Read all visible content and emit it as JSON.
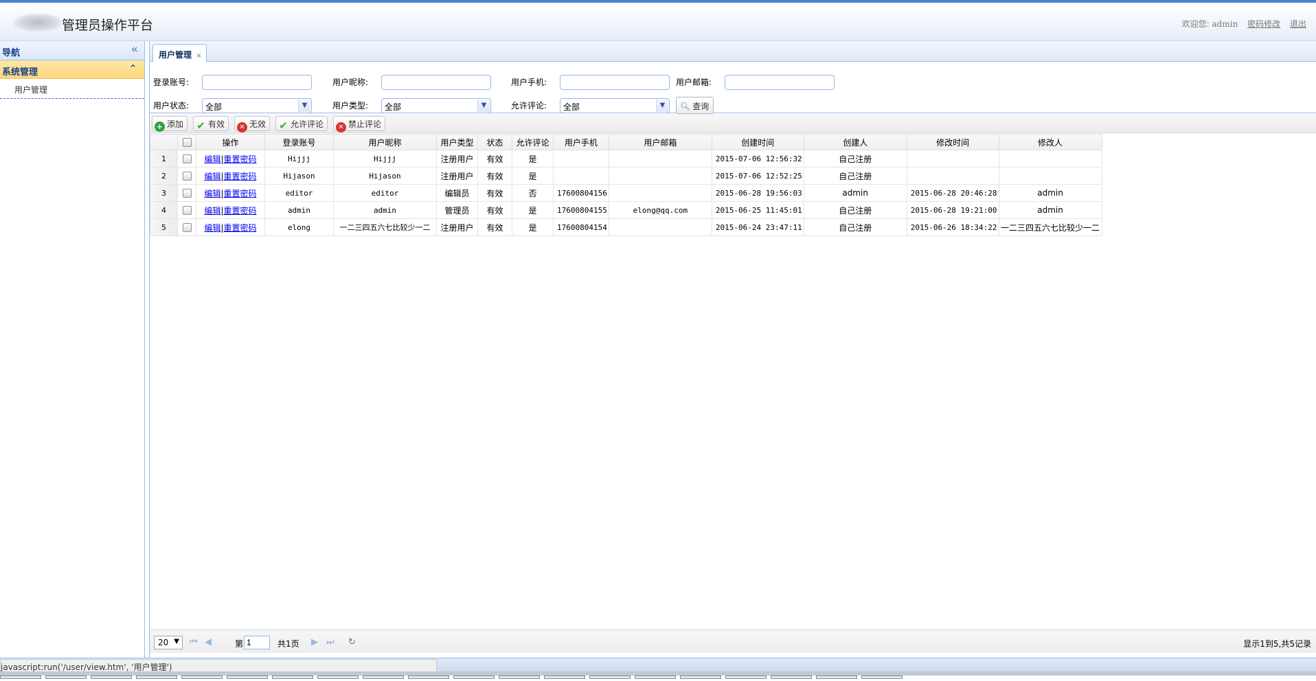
{
  "header": {
    "app_title": "管理员操作平台",
    "welcome": "欢迎您:",
    "username": "admin",
    "change_password": "密码修改",
    "logout": "退出"
  },
  "sidebar": {
    "title": "导航",
    "group_title": "系统管理",
    "items": [
      {
        "label": "用户管理"
      }
    ]
  },
  "tabs": [
    {
      "label": "用户管理",
      "close": "×"
    }
  ],
  "search": {
    "login_account": {
      "label": "登录账号:",
      "value": ""
    },
    "nickname": {
      "label": "用户昵称:",
      "value": ""
    },
    "phone": {
      "label": "用户手机:",
      "value": ""
    },
    "email": {
      "label": "用户邮箱:",
      "value": ""
    },
    "status": {
      "label": "用户状态:",
      "value": "全部"
    },
    "type": {
      "label": "用户类型:",
      "value": "全部"
    },
    "comment": {
      "label": "允许评论:",
      "value": "全部"
    },
    "query_button": "查询"
  },
  "toolbar": {
    "add": "添加",
    "valid": "有效",
    "invalid": "无效",
    "allow_comment": "允许评论",
    "forbid_comment": "禁止评论"
  },
  "grid": {
    "columns": [
      "操作",
      "登录账号",
      "用户昵称",
      "用户类型",
      "状态",
      "允许评论",
      "用户手机",
      "用户邮箱",
      "创建时间",
      "创建人",
      "修改时间",
      "修改人"
    ],
    "op_edit": "编辑",
    "op_sep": "|",
    "op_reset": "重置密码",
    "rows": [
      {
        "n": "1",
        "account": "Hijjj",
        "nickname": "Hijjj",
        "type": "注册用户",
        "status": "有效",
        "comment": "是",
        "phone": "",
        "email": "",
        "created": "2015-07-06 12:56:32",
        "creator": "自己注册",
        "modified": "",
        "modifier": ""
      },
      {
        "n": "2",
        "account": "Hijason",
        "nickname": "Hijason",
        "type": "注册用户",
        "status": "有效",
        "comment": "是",
        "phone": "",
        "email": "",
        "created": "2015-07-06 12:52:25",
        "creator": "自己注册",
        "modified": "",
        "modifier": ""
      },
      {
        "n": "3",
        "account": "editor",
        "nickname": "editor",
        "type": "编辑员",
        "status": "有效",
        "comment": "否",
        "phone": "17600804156",
        "email": "",
        "created": "2015-06-28 19:56:03",
        "creator": "admin",
        "modified": "2015-06-28 20:46:28",
        "modifier": "admin"
      },
      {
        "n": "4",
        "account": "admin",
        "nickname": "admin",
        "type": "管理员",
        "status": "有效",
        "comment": "是",
        "phone": "17600804155",
        "email": "elong@qq.com",
        "created": "2015-06-25 11:45:01",
        "creator": "自己注册",
        "modified": "2015-06-28 19:21:00",
        "modifier": "admin"
      },
      {
        "n": "5",
        "account": "elong",
        "nickname": "一二三四五六七比较少一二",
        "type": "注册用户",
        "status": "有效",
        "comment": "是",
        "phone": "17600804154",
        "email": "",
        "created": "2015-06-24 23:47:11",
        "creator": "自己注册",
        "modified": "2015-06-26 18:34:22",
        "modifier": "一二三四五六七比较少一二"
      }
    ]
  },
  "pager": {
    "page_size": "20",
    "page_prefix": "第",
    "page_value": "1",
    "page_total": "共1页",
    "info": "显示1到5,共5记录"
  },
  "statusbar": {
    "text": "javascript:run('/user/view.htm', '用户管理')"
  }
}
